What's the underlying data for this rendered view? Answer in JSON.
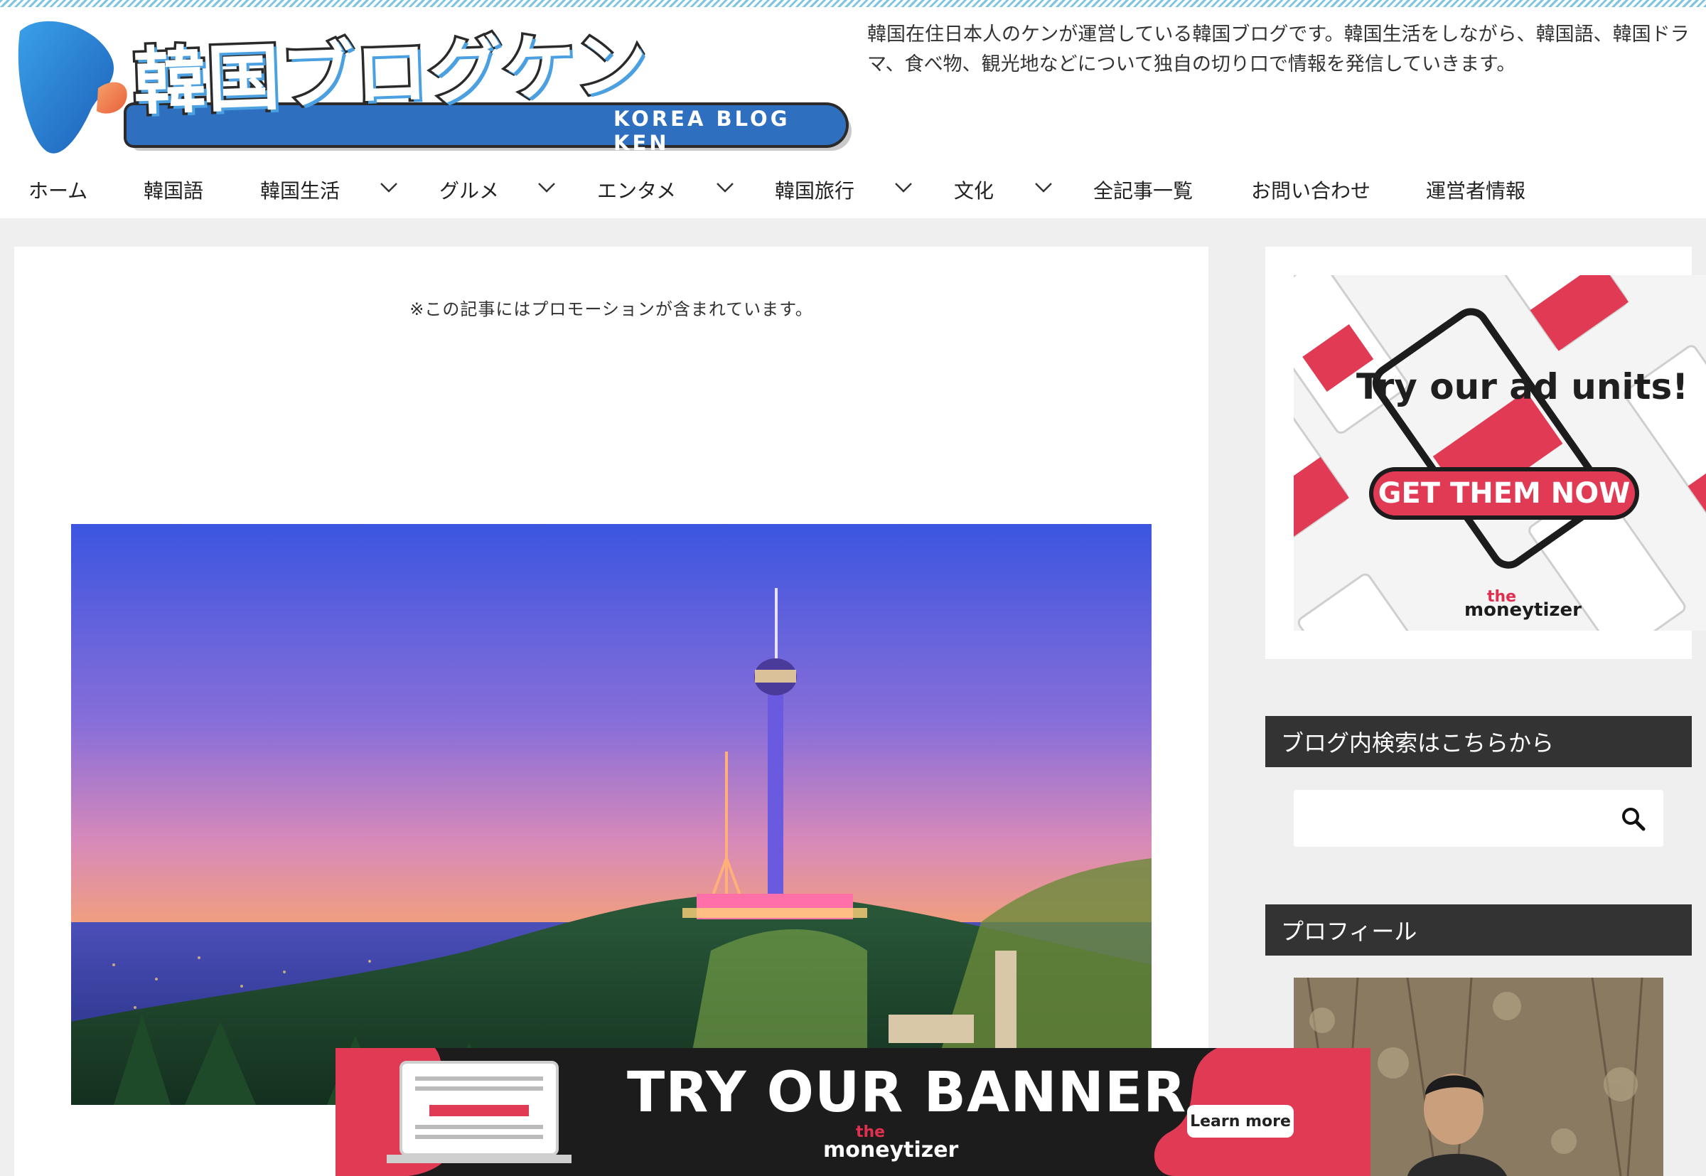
{
  "site": {
    "logo_title": "韓国ブログケン",
    "logo_subtitle": "KOREA BLOG KEN",
    "tagline": "韓国在住日本人のケンが運営している韓国ブログです。韓国生活をしながら、韓国語、韓国ドラマ、食べ物、観光地などについて独自の切り口で情報を発信していきます。"
  },
  "nav": {
    "items": [
      {
        "label": "ホーム",
        "has_submenu": false
      },
      {
        "label": "韓国語",
        "has_submenu": false
      },
      {
        "label": "韓国生活",
        "has_submenu": true
      },
      {
        "label": "グルメ",
        "has_submenu": true
      },
      {
        "label": "エンタメ",
        "has_submenu": true
      },
      {
        "label": "韓国旅行",
        "has_submenu": true
      },
      {
        "label": "文化",
        "has_submenu": true
      },
      {
        "label": "全記事一覧",
        "has_submenu": false
      },
      {
        "label": "お問い合わせ",
        "has_submenu": false
      },
      {
        "label": "運営者情報",
        "has_submenu": false
      }
    ]
  },
  "article": {
    "promo_note": "※この記事にはプロモーションが含まれています。"
  },
  "sidebar": {
    "ad": {
      "headline": "Try our ad units!",
      "cta": "GET THEM NOW",
      "brand_the": "the",
      "brand_name": "moneytizer"
    },
    "search_widget": {
      "title": "ブログ内検索はこちらから",
      "placeholder": "",
      "icon": "search-icon"
    },
    "profile_widget": {
      "title": "プロフィール"
    }
  },
  "bottom_banner": {
    "headline": "TRY OUR BANNER",
    "cta": "Learn more",
    "brand_the": "the",
    "brand_name": "moneytizer"
  },
  "colors": {
    "accent_blue": "#2f6fc0",
    "widget_header": "#333333",
    "ad_red": "#e03a55",
    "page_bg": "#efefef"
  }
}
